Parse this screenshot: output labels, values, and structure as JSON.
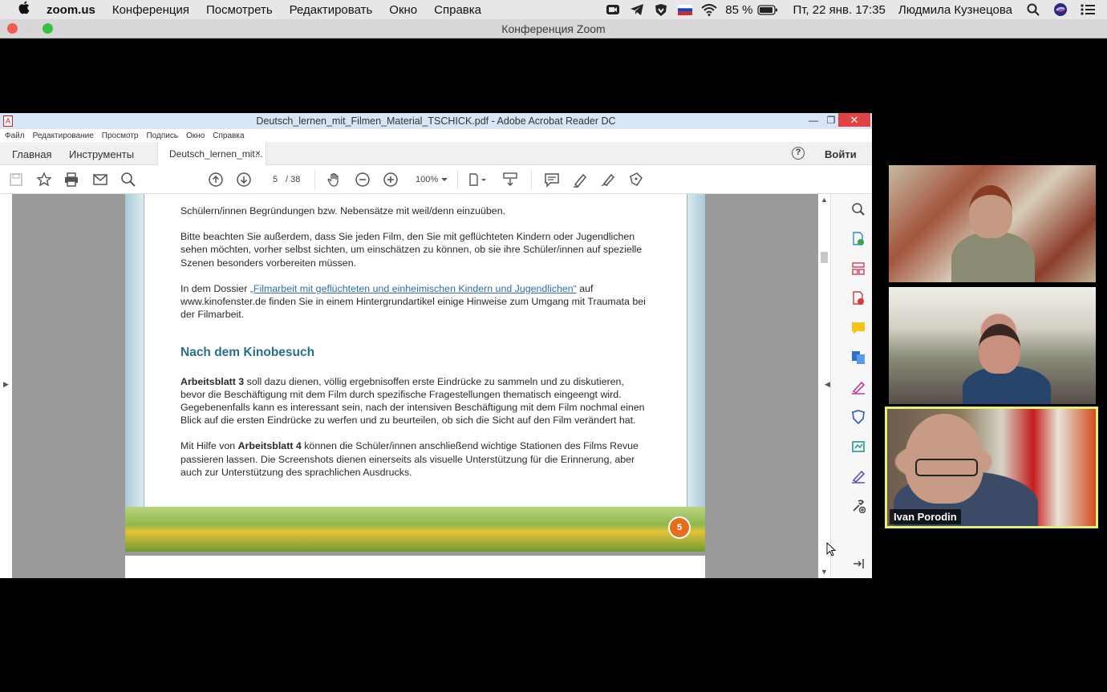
{
  "menubar": {
    "app": "zoom.us",
    "items": [
      "Конференция",
      "Посмотреть",
      "Редактировать",
      "Окно",
      "Справка"
    ],
    "battery": "85 %",
    "datetime": "Пт, 22 янв.  17:35",
    "user": "Людмила Кузнецова"
  },
  "zoom": {
    "window_title": "Конференция Zoom"
  },
  "acrobat": {
    "window_title": "Deutsch_lernen_mit_Filmen_Material_TSCHICK.pdf - Adobe Acrobat Reader DC",
    "menu": [
      "Файл",
      "Редактирование",
      "Просмотр",
      "Подпись",
      "Окно",
      "Справка"
    ],
    "tabs": {
      "home": "Главная",
      "tools": "Инструменты",
      "doc": "Deutsch_lernen_mit...",
      "close": "×"
    },
    "help": "?",
    "login": "Войти",
    "page_current": "5",
    "page_total": "/ 38",
    "zoom": "100%",
    "page_number_badge": "5"
  },
  "document": {
    "p1": "Schülern/innen Begründungen bzw. Nebensätze mit weil/denn einzuüben.",
    "p2": "Bitte beachten Sie außerdem, dass Sie jeden Film, den Sie mit geflüchteten Kindern oder Jugendlichen sehen möchten, vorher selbst sichten, um einschätzen zu können, ob sie ihre Schüler/innen auf spezielle Szenen besonders vorbereiten müssen.",
    "p3_pre": "In dem Dossier ",
    "p3_link": "„Filmarbeit mit geflüchteten und einheimischen Kindern und Jugendlichen“",
    "p3_post": " auf www.kinofenster.de finden Sie in einem Hintergrundartikel einige Hinweise zum Umgang mit Traumata bei der Filmarbeit.",
    "heading": "Nach dem Kinobesuch",
    "p4_bold": "Arbeitsblatt 3",
    "p4": " soll dazu dienen, völlig ergebnisoffen erste Eindrücke zu sammeln und zu diskutieren, bevor die Beschäftigung mit dem Film durch spezifische Fragestellungen thematisch eingeengt wird. Gegebenenfalls kann es interessant sein, nach der intensiven Beschäftigung mit dem Film nochmal einen Blick auf die ersten Eindrücke zu werfen und zu beurteilen, ob sich die Sicht auf den Film verändert hat.",
    "p5_pre": "Mit Hilfe von ",
    "p5_bold": "Arbeitsblatt 4",
    "p5": " können die Schüler/innen anschließend wichtige Stationen des Films Revue passieren lassen. Die Screenshots dienen einerseits als visuelle Unterstützung für die Erinnerung, aber auch zur Unterstützung des sprachlichen Ausdrucks."
  },
  "participants": [
    {
      "name": ""
    },
    {
      "name": ""
    },
    {
      "name": "Ivan Porodin",
      "active_speaker": true
    }
  ],
  "colors": {
    "active_speaker_border": "#e6f26b",
    "link": "#2f6ea5",
    "heading": "#2a6f8a",
    "page_badge": "#e46e1b"
  }
}
